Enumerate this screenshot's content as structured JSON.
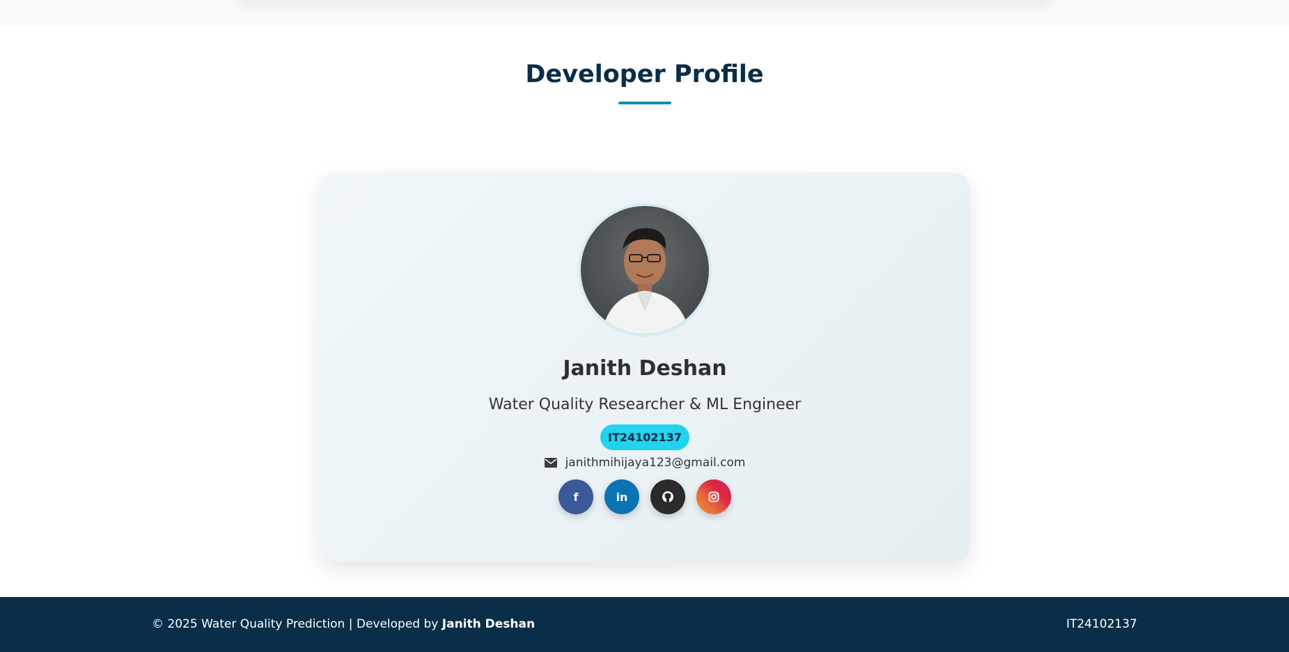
{
  "section": {
    "title": "Developer Profile"
  },
  "profile": {
    "name": "Janith Deshan",
    "role": "Water Quality Researcher & ML Engineer",
    "student_id": "IT24102137",
    "email": "janithmihijaya123@gmail.com",
    "avatar_alt": "avatar",
    "socials": [
      {
        "icon": "facebook-icon",
        "glyph": "f",
        "color": "#3b5998"
      },
      {
        "icon": "linkedin-icon",
        "glyph": "in",
        "color": "#0a74b3"
      },
      {
        "icon": "github-icon",
        "glyph": "",
        "color": "#2b2b2b"
      },
      {
        "icon": "instagram-icon",
        "glyph": "",
        "color": "#dc2743"
      }
    ]
  },
  "footer": {
    "copyright": "© 2025 Water Quality Prediction | Developed by",
    "developer": "Janith Deshan",
    "id": "IT24102137"
  },
  "colors": {
    "accent": "#0e8fb5",
    "navy": "#0a2d48",
    "badge": "#22d3ee"
  }
}
